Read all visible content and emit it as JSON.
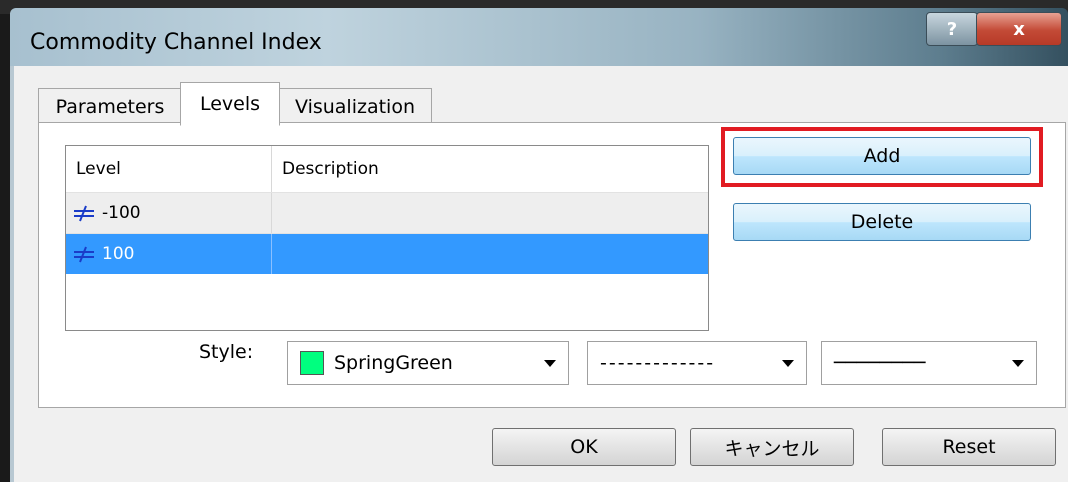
{
  "window": {
    "title": "Commodity Channel Index",
    "help_label": "?",
    "close_label": "x"
  },
  "tabs": [
    {
      "label": "Parameters",
      "active": false
    },
    {
      "label": "Levels",
      "active": true
    },
    {
      "label": "Visualization",
      "active": false
    }
  ],
  "levels_table": {
    "headers": [
      "Level",
      "Description"
    ],
    "rows": [
      {
        "level": "-100",
        "description": "",
        "selected": false
      },
      {
        "level": "100",
        "description": "",
        "selected": true
      }
    ]
  },
  "buttons": {
    "add": "Add",
    "delete": "Delete",
    "ok": "OK",
    "cancel": "キャンセル",
    "reset": "Reset"
  },
  "style": {
    "label": "Style:",
    "color_name": "SpringGreen",
    "color_hex": "#00ff7f",
    "line_style_text": "-------------",
    "line_width_text": "────────"
  },
  "colors": {
    "selection": "#3399ff",
    "highlight": "#e11b22"
  }
}
